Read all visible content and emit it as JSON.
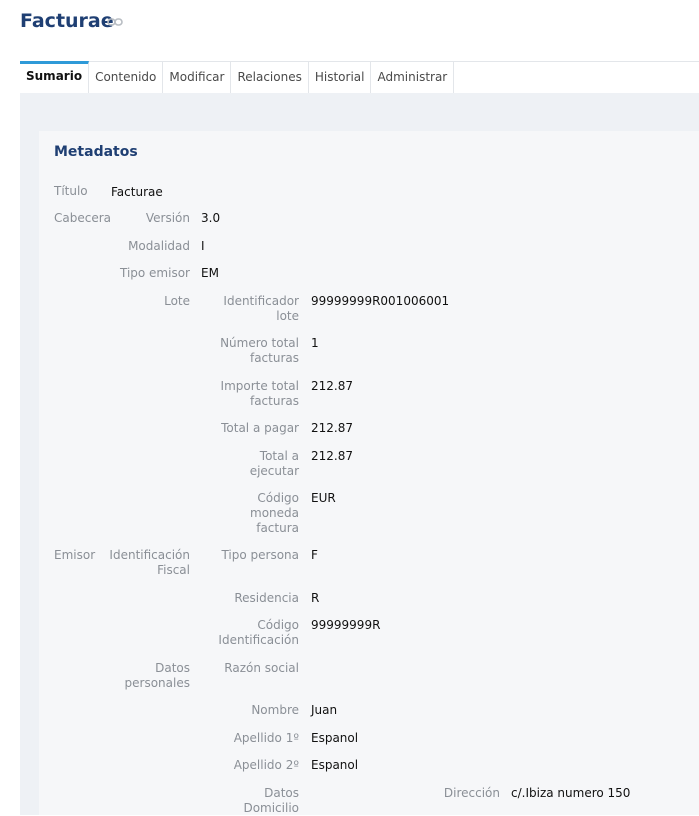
{
  "page": {
    "title": "Facturae"
  },
  "tabs": [
    "Sumario",
    "Contenido",
    "Modificar",
    "Relaciones",
    "Historial",
    "Administrar"
  ],
  "section": {
    "title": "Metadatos"
  },
  "fields": {
    "titulo_label": "Título",
    "titulo_value": "Facturae",
    "cabecera": "Cabecera",
    "version_label": "Versión",
    "version_value": "3.0",
    "modalidad_label": "Modalidad",
    "modalidad_value": "I",
    "tipo_emisor_label": "Tipo emisor",
    "tipo_emisor_value": "EM",
    "lote": "Lote",
    "identificador_lote_label": "Identificador lote",
    "identificador_lote_value": "99999999R001006001",
    "numero_total_label": "Número total facturas",
    "numero_total_value": "1",
    "importe_total_label": "Importe total facturas",
    "importe_total_value": "212.87",
    "total_pagar_label": "Total a pagar",
    "total_pagar_value": "212.87",
    "total_ejecutar_label": "Total a ejecutar",
    "total_ejecutar_value": "212.87",
    "codigo_moneda_label": "Código moneda factura",
    "codigo_moneda_value": "EUR",
    "emisor": "Emisor",
    "identificacion_fiscal": "Identificación Fiscal",
    "tipo_persona_label": "Tipo persona",
    "tipo_persona_value": "F",
    "residencia_label": "Residencia",
    "residencia_value": "R",
    "codigo_identificacion_label": "Código Identificación",
    "codigo_identificacion_value": "99999999R",
    "datos_personales": "Datos personales",
    "razon_social_label": "Razón social",
    "nombre_label": "Nombre",
    "nombre_value": "Juan",
    "apellido1_label": "Apellido 1º",
    "apellido1_value": "Espanol",
    "apellido2_label": "Apellido 2º",
    "apellido2_value": "Espanol",
    "datos_domicilio": "Datos Domicilio",
    "direccion_label": "Dirección",
    "direccion_value": "c/.Ibiza numero 150"
  },
  "colors": {
    "title": "#1f3f73",
    "tab_active_border": "#2e9ad8",
    "label": "#8a8f96"
  },
  "icons": {
    "title_link": "link-icon"
  }
}
